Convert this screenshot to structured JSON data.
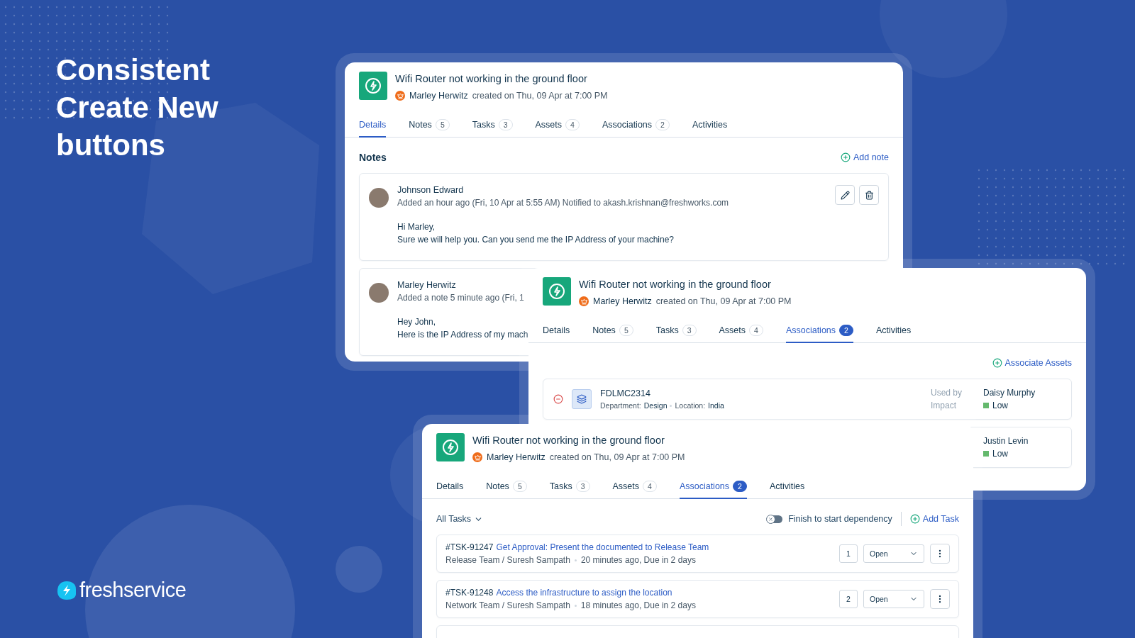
{
  "headline": "Consistent Create New buttons",
  "brand": "freshservice",
  "cards": [
    {
      "ticket": {
        "title": "Wifi Router not working in the ground floor",
        "author": "Marley Herwitz",
        "created": "created on Thu, 09 Apr at 7:00 PM"
      },
      "tabs": [
        {
          "label": "Details",
          "selected": true
        },
        {
          "label": "Notes",
          "count": "5",
          "selected": false
        },
        {
          "label": "Tasks",
          "count": "3",
          "selected": false
        },
        {
          "label": "Assets",
          "count": "4",
          "selected": false
        },
        {
          "label": "Associations",
          "count": "2",
          "selected": false
        },
        {
          "label": "Activities",
          "selected": false
        }
      ],
      "section": {
        "kind": "notes",
        "title": "Notes",
        "action": "Add note",
        "notes": [
          {
            "author": "Johnson Edward",
            "meta": "Added an hour ago (Fri, 10 Apr at 5:55 AM) Notified to akash.krishnan@freshworks.com",
            "body": [
              "Hi Marley,",
              "Sure we will help you. Can you send me the IP Address of your machine?"
            ],
            "actions": [
              {
                "kind": "edit"
              },
              {
                "kind": "delete"
              }
            ]
          },
          {
            "author": "Marley Herwitz",
            "meta": "Added a note 5 minute ago (Fri, 1",
            "body": [
              "Hey John,",
              "Here is the IP Address of my mach"
            ]
          }
        ]
      }
    },
    {
      "ticket": {
        "title": "Wifi Router not working in the ground floor",
        "author": "Marley Herwitz",
        "created": "created on Thu, 09 Apr at 7:00 PM"
      },
      "tabs": [
        {
          "label": "Details",
          "selected": false
        },
        {
          "label": "Notes",
          "count": "5",
          "selected": false
        },
        {
          "label": "Tasks",
          "count": "3",
          "selected": false
        },
        {
          "label": "Assets",
          "count": "4",
          "selected": false
        },
        {
          "label": "Associations",
          "count": "2",
          "selected": true
        },
        {
          "label": "Activities",
          "selected": false
        }
      ],
      "section": {
        "kind": "assets",
        "action": "Associate Assets",
        "assets": [
          {
            "name": "FDLMC2314",
            "fields": [
              {
                "label": "Department:",
                "value": "Design"
              },
              {
                "label": "Location:",
                "value": "India"
              }
            ],
            "used_by_label": "Used by",
            "impact_label": "Impact",
            "used_by": "Daisy Murphy",
            "impact": "Low"
          },
          {
            "used_by": "Justin Levin",
            "impact": "Low"
          }
        ]
      }
    },
    {
      "ticket": {
        "title": "Wifi Router not working in the ground floor",
        "author": "Marley Herwitz",
        "created": "created on Thu, 09 Apr at 7:00 PM"
      },
      "tabs": [
        {
          "label": "Details",
          "selected": false
        },
        {
          "label": "Notes",
          "count": "5",
          "selected": false
        },
        {
          "label": "Tasks",
          "count": "3",
          "selected": false
        },
        {
          "label": "Assets",
          "count": "4",
          "selected": false
        },
        {
          "label": "Associations",
          "count": "2",
          "selected": true
        },
        {
          "label": "Activities",
          "selected": false
        }
      ],
      "section": {
        "kind": "tasks",
        "filter": "All Tasks",
        "toggle": {
          "label": "Finish to start dependency",
          "on": false
        },
        "action": "Add Task",
        "tasks": [
          {
            "id": "#TSK-91247",
            "title": "Get Approval: Present the documented to Release Team",
            "team": "Release Team / Suresh Sampath",
            "time": "20 minutes ago, Due in 2 days",
            "order": "1",
            "status": "Open"
          },
          {
            "id": "#TSK-91248",
            "title": "Access the infrastructure to assign the location",
            "team": "Network Team / Suresh Sampath",
            "time": "18 minutes ago, Due in 2 days",
            "order": "2",
            "status": "Open"
          }
        ]
      }
    }
  ]
}
